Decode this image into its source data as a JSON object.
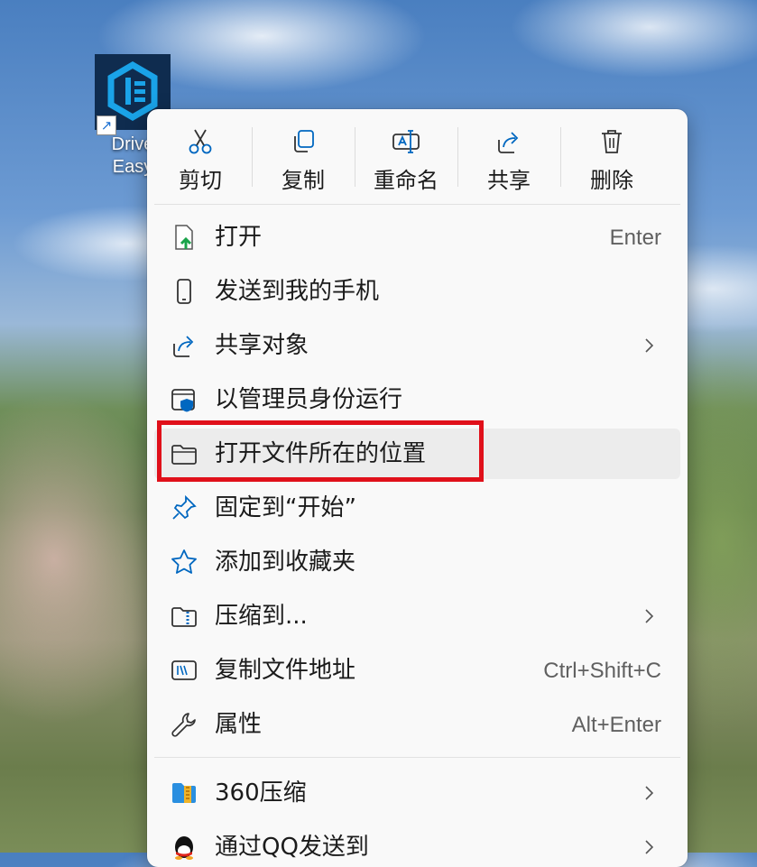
{
  "desktop_icon": {
    "name_line1": "Drive",
    "name_line2": "Easy"
  },
  "toolbar": {
    "cut_label": "剪切",
    "copy_label": "复制",
    "rename_label": "重命名",
    "share_label": "共享",
    "delete_label": "删除"
  },
  "menu_items": [
    {
      "label": "打开",
      "shortcut": "Enter",
      "icon": "open-file-icon"
    },
    {
      "label": "发送到我的手机",
      "icon": "phone-icon"
    },
    {
      "label": "共享对象",
      "icon": "share-icon",
      "has_submenu": true
    },
    {
      "label": "以管理员身份运行",
      "icon": "admin-shield-icon"
    },
    {
      "label": "打开文件所在的位置",
      "icon": "folder-icon",
      "highlighted": true
    },
    {
      "label": "固定到“开始”",
      "icon": "pin-icon"
    },
    {
      "label": "添加到收藏夹",
      "icon": "star-icon"
    },
    {
      "label": "压缩到...",
      "icon": "zip-folder-icon",
      "has_submenu": true
    },
    {
      "label": "复制文件地址",
      "shortcut": "Ctrl+Shift+C",
      "icon": "path-icon"
    },
    {
      "label": "属性",
      "shortcut": "Alt+Enter",
      "icon": "wrench-icon"
    }
  ],
  "extra_items": [
    {
      "label": "360压缩",
      "icon": "360-zip-icon",
      "has_submenu": true
    },
    {
      "label": "通过QQ发送到",
      "icon": "qq-icon",
      "has_submenu": true
    }
  ],
  "colors": {
    "accent": "#0067c0",
    "highlight_border": "#e0101a",
    "menu_bg": "#f9f9f9"
  }
}
